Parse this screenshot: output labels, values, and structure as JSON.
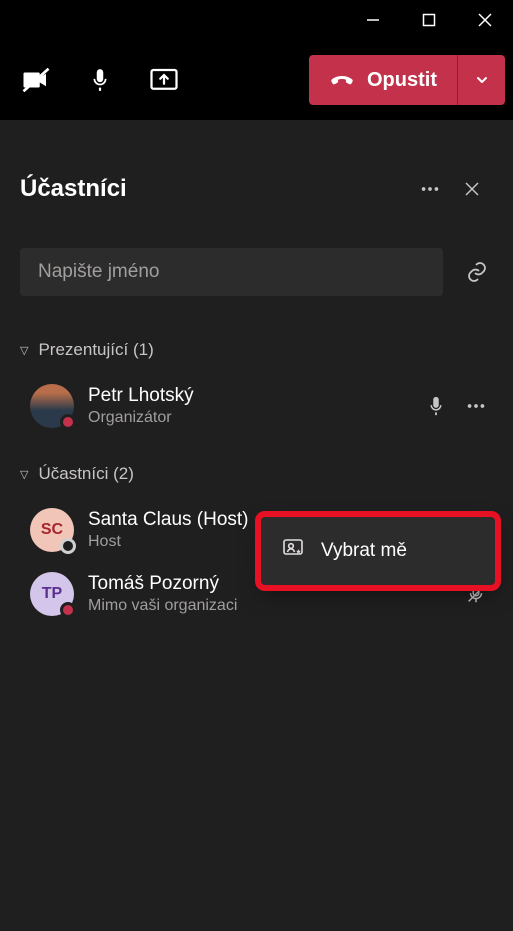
{
  "toolbar": {
    "leave_label": "Opustit"
  },
  "panel": {
    "title": "Účastníci",
    "search_placeholder": "Napište jméno"
  },
  "sections": {
    "presenters": {
      "label": "Prezentující (1)",
      "items": [
        {
          "name": "Petr Lhotský",
          "sub": "Organizátor",
          "initials": ""
        }
      ]
    },
    "attendees": {
      "label": "Účastníci (2)",
      "items": [
        {
          "name": "Santa Claus (Host)",
          "sub": "Host",
          "initials": "SC"
        },
        {
          "name": "Tomáš Pozorný",
          "sub": "Mimo vaši organizaci",
          "initials": "TP"
        }
      ]
    }
  },
  "context_menu": {
    "spotlight_label": "Vybrat mě"
  }
}
